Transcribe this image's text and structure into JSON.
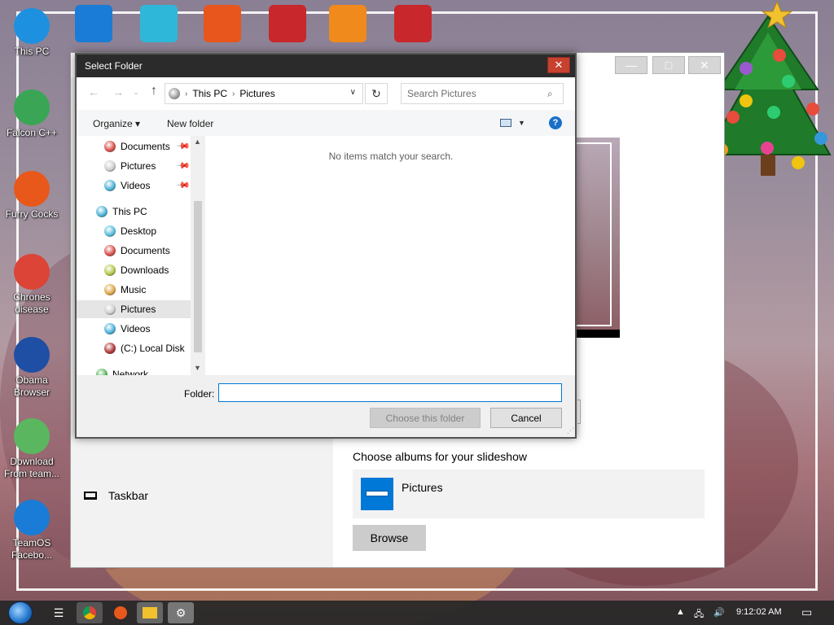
{
  "desktop": {
    "left_icons": [
      {
        "label": "This PC",
        "icon": "computer-icon",
        "color": "#1e90e0"
      },
      {
        "label": "Falcon C++",
        "icon": "recycle-icon",
        "color": "#3aa655"
      },
      {
        "label": "Furry Cocks",
        "icon": "firefox-icon",
        "color": "#e8581b"
      },
      {
        "label": "Chrones disease",
        "icon": "chrome-icon",
        "color": "#db4437"
      },
      {
        "label": "Obama Browser",
        "icon": "obama-logo-icon",
        "color": "#1f4fa5"
      },
      {
        "label": "Download From team...",
        "icon": "notepad-icon",
        "color": "#5ab75f"
      },
      {
        "label": "TeamOS Facebo...",
        "icon": "gear-icon",
        "color": "#1a7cd6"
      }
    ],
    "top_icons": [
      {
        "icon": "gear-icon",
        "color": "#1a7cd6"
      },
      {
        "icon": "diamond-icon",
        "color": "#2fb7d9"
      },
      {
        "icon": "letter-p-icon",
        "color": "#e8561e"
      },
      {
        "icon": "angry-bird-icon",
        "color": "#c8282c"
      },
      {
        "icon": "vlc-icon",
        "color": "#f08a1c"
      },
      {
        "icon": "gift-icon",
        "color": "#c8282c"
      }
    ]
  },
  "background_window": {
    "taskbar_item": "Taskbar",
    "albums_heading": "Choose albums for your slideshow",
    "album_name": "Pictures",
    "browse_label": "Browse"
  },
  "dialog": {
    "title": "Select Folder",
    "close_glyph": "✕",
    "address": {
      "root": "This PC",
      "current": "Pictures"
    },
    "search_placeholder": "Search Pictures",
    "organize_label": "Organize",
    "new_folder_label": "New folder",
    "help_glyph": "?",
    "empty_message": "No items match your search.",
    "tree": {
      "quick_access": [
        {
          "label": "Documents",
          "color": "#d9534f",
          "pinned": true
        },
        {
          "label": "Pictures",
          "color": "#cfcfcf",
          "pinned": true
        },
        {
          "label": "Videos",
          "color": "#4fb3d9",
          "pinned": true
        }
      ],
      "this_pc": {
        "label": "This PC",
        "color": "#4fb3d9"
      },
      "this_pc_children": [
        {
          "label": "Desktop",
          "color": "#5bc0de"
        },
        {
          "label": "Documents",
          "color": "#d9534f"
        },
        {
          "label": "Downloads",
          "color": "#b5c84a"
        },
        {
          "label": "Music",
          "color": "#e0a84a"
        },
        {
          "label": "Pictures",
          "color": "#cfcfcf",
          "selected": true
        },
        {
          "label": "Videos",
          "color": "#4fb3d9"
        },
        {
          "label": "(C:) Local Disk",
          "color": "#b33a3a"
        }
      ],
      "network": {
        "label": "Network",
        "color": "#5cb85c"
      }
    },
    "folder_label": "Folder:",
    "folder_value": "",
    "choose_label": "Choose this folder",
    "cancel_label": "Cancel"
  },
  "taskbar": {
    "clock": "9:12:02 AM"
  },
  "colors": {
    "dialog_title_bg": "#2b2b2b",
    "accent": "#0078d7",
    "close_red": "#c7412f"
  }
}
